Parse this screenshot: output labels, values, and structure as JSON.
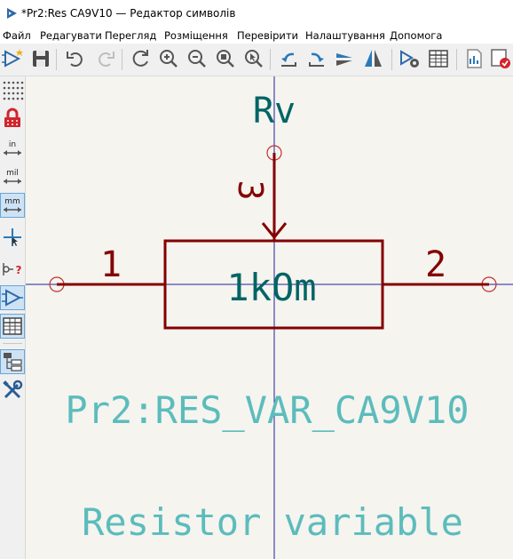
{
  "window": {
    "title": "*Pr2:Res CA9V10 — Редактор символів"
  },
  "menu": {
    "items": [
      {
        "label": "Файл"
      },
      {
        "label": "Редагувати"
      },
      {
        "label": "Перегляд"
      },
      {
        "label": "Розміщення"
      },
      {
        "label": "Перевірити"
      },
      {
        "label": "Налаштування"
      },
      {
        "label": "Допомога"
      }
    ]
  },
  "toolbar": {
    "icons": [
      "new-symbol-icon",
      "save-icon",
      "undo-icon",
      "redo-icon",
      "refresh-icon",
      "zoom-in-icon",
      "zoom-out-icon",
      "zoom-fit-icon",
      "zoom-selection-icon",
      "rotate-ccw-icon",
      "rotate-cw-icon",
      "mirror-vertical-icon",
      "mirror-horizontal-icon",
      "symbol-properties-icon",
      "pin-table-icon",
      "datasheet-icon",
      "check-symbol-icon"
    ]
  },
  "left_toolbar": {
    "icons": [
      "grid-icon",
      "lock-icon",
      "units-inches-icon",
      "units-mils-icon",
      "units-mm-icon",
      "cursor-icon",
      "pin-types-icon",
      "symbol-editor-icon",
      "table-icon",
      "tree-icon",
      "tools-icon"
    ],
    "units": {
      "in": "in",
      "mil": "mil",
      "mm": "mm"
    }
  },
  "symbol": {
    "reference": "Rv",
    "value": "1kOm",
    "name": "Pr2:RES_VAR_CA9V10",
    "description": "Resistor variable",
    "pins": [
      {
        "number": "1"
      },
      {
        "number": "2"
      },
      {
        "number": "3"
      }
    ]
  },
  "colors": {
    "canvas_background": "#f5f4ef",
    "body_outline": "#840000",
    "pin": "#840000",
    "reference_text": "#006464",
    "value_text": "#006464",
    "hidden_field_text": "#5cbcbc",
    "crosshair": "#2020a0",
    "accent": "#2a7ab8"
  }
}
